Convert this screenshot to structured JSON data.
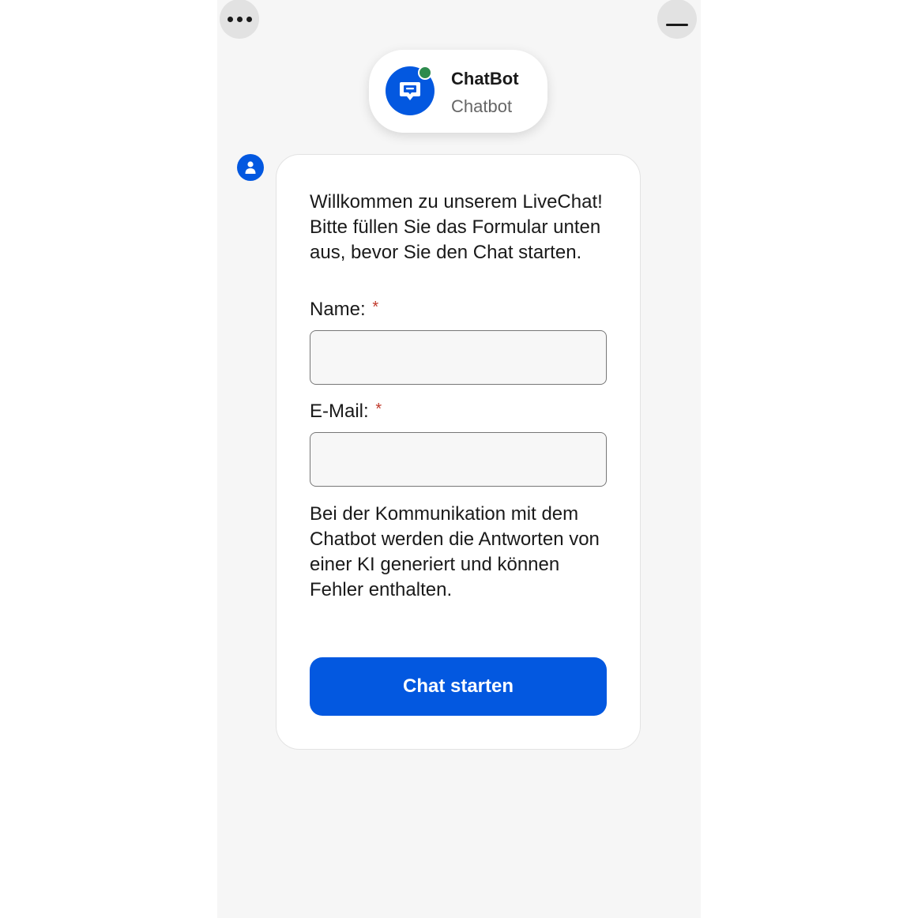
{
  "header": {
    "menu_icon": "more-horizontal-icon",
    "minimize_icon": "minimize-icon"
  },
  "agent": {
    "name": "ChatBot",
    "role": "Chatbot",
    "avatar_icon": "chat-bubble-icon",
    "status": "online",
    "status_color": "#2e8b4e"
  },
  "message": {
    "avatar_icon": "user-icon",
    "intro": "Willkommen zu unserem LiveChat! Bitte füllen Sie das Formular unten aus, bevor Sie den Chat starten."
  },
  "form": {
    "name_label": "Name:",
    "name_required": "*",
    "name_value": "",
    "email_label": "E-Mail:",
    "email_required": "*",
    "email_value": "",
    "disclaimer": "Bei der Kommunikation mit dem Chatbot werden die Antworten von einer KI generiert und können Fehler enthalten.",
    "submit_label": "Chat starten"
  },
  "colors": {
    "accent": "#0358e0",
    "required": "#c0392b",
    "panel_background": "#f6f6f6"
  }
}
